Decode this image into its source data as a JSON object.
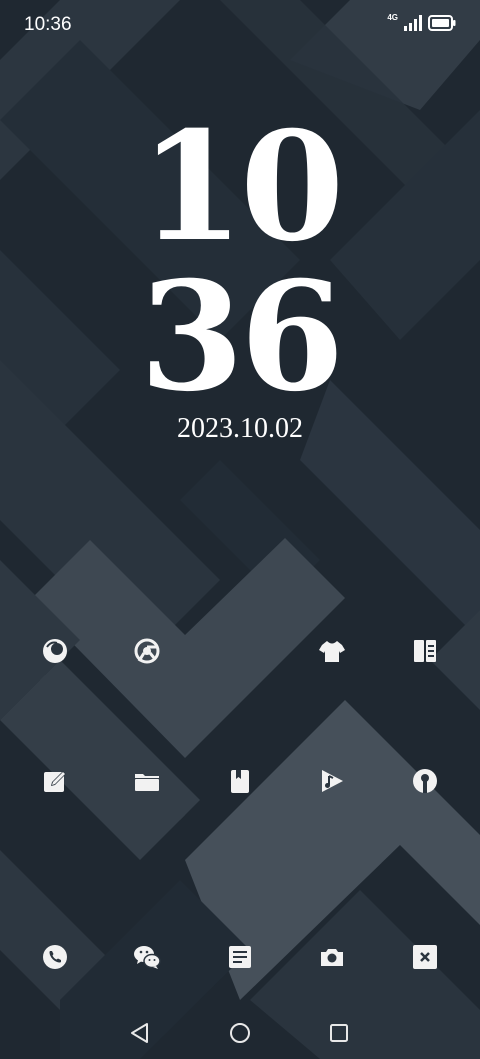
{
  "status_bar": {
    "time": "10:36",
    "network": "4G",
    "signal_icon": "cell-signal-icon",
    "battery_icon": "battery-icon"
  },
  "lock_clock": {
    "hours": "10",
    "minutes": "36",
    "date": "2023.10.02"
  },
  "icon_color": "#f2f2f2",
  "apps_row1": [
    {
      "icon": "browser-icon"
    },
    {
      "icon": "chrome-icon"
    },
    {
      "icon": "tshirt-icon"
    },
    {
      "icon": "book-reader-icon"
    }
  ],
  "apps_row2": [
    {
      "icon": "note-edit-icon"
    },
    {
      "icon": "folder-icon"
    },
    {
      "icon": "bookmark-book-icon"
    },
    {
      "icon": "music-play-icon"
    },
    {
      "icon": "vpn-keyhole-icon"
    }
  ],
  "dock": [
    {
      "icon": "phone-icon"
    },
    {
      "icon": "wechat-icon"
    },
    {
      "icon": "notes-icon"
    },
    {
      "icon": "camera-icon"
    },
    {
      "icon": "close-box-icon"
    }
  ],
  "nav_bar": {
    "back_icon": "back-triangle-icon",
    "home_icon": "home-circle-icon",
    "recents_icon": "recents-square-icon"
  }
}
